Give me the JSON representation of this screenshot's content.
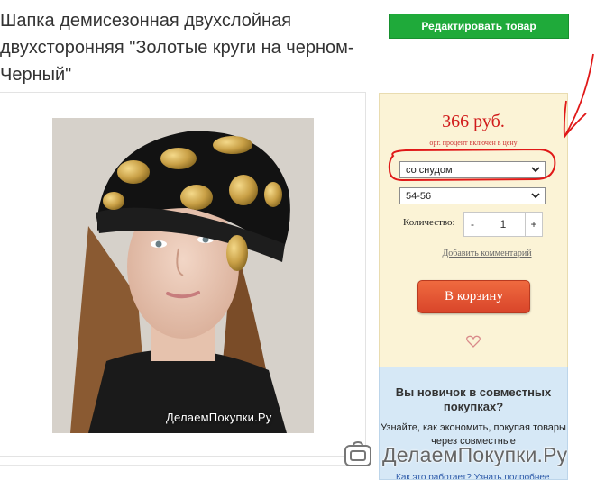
{
  "product": {
    "title": "Шапка демисезонная двухслойная двухсторонняя \"Золотые круги на черном-Черный\"",
    "edit_button": "Редактировать товар",
    "photo_watermark": "ДелаемПокупки.Ру"
  },
  "buy": {
    "price": "366 руб.",
    "price_note": "орг. процент включен в цену",
    "modification_value": "со снудом",
    "size_value": "54-56",
    "quantity_label": "Количество:",
    "quantity_minus": "-",
    "quantity_value": "1",
    "quantity_plus": "+",
    "comment_link": "Добавить комментарий",
    "cart_button": "В корзину"
  },
  "newbie": {
    "title": "Вы новичок в совместных покупках?",
    "text": "Узнайте, как экономить, покупая товары через совместные",
    "link": "Как это работает? Узнать подробнее"
  },
  "site_watermark": "ДелаемПокупки.Ру",
  "colors": {
    "accent_green": "#1faa3a",
    "price_red": "#d01a1a",
    "cart_orange": "#e3532f",
    "panel_yellow": "#fbf3d6",
    "panel_blue": "#d6e8f6",
    "annotation_red": "#e01818"
  }
}
